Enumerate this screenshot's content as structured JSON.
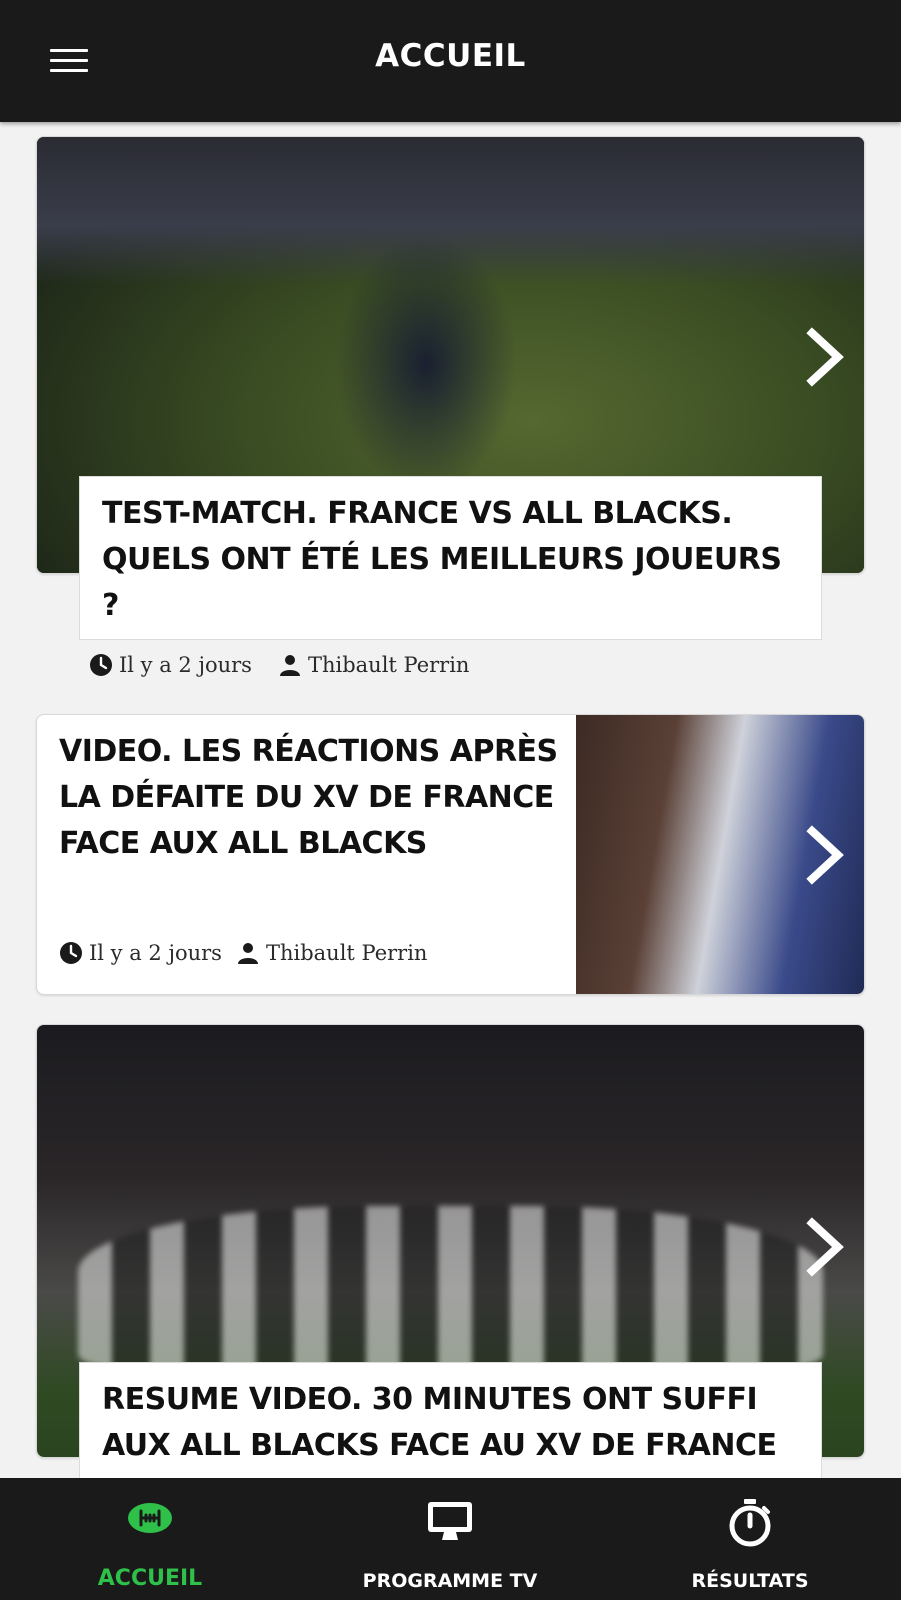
{
  "header": {
    "title": "ACCUEIL",
    "menu_icon": "hamburger-menu-icon"
  },
  "articles": [
    {
      "title": "TEST-MATCH. FRANCE VS ALL BLACKS. QUELS ONT ÉTÉ LES MEILLEURS JOUEURS ?",
      "time": "Il y a 2 jours",
      "author": "Thibault Perrin"
    },
    {
      "title": "VIDEO. LES RÉACTIONS APRÈS LA DÉFAITE DU XV DE FRANCE FACE AUX ALL BLACKS",
      "time": "Il y a 2 jours",
      "author": "Thibault Perrin"
    },
    {
      "title": "RESUME VIDEO. 30 MINUTES ONT SUFFI AUX ALL BLACKS FACE AU XV DE FRANCE"
    }
  ],
  "bottom_nav": {
    "items": [
      {
        "label": "ACCUEIL",
        "icon": "rugby-ball-icon",
        "active": true
      },
      {
        "label": "PROGRAMME TV",
        "icon": "monitor-icon",
        "active": false
      },
      {
        "label": "RÉSULTATS",
        "icon": "stopwatch-icon",
        "active": false
      }
    ]
  },
  "colors": {
    "bar_background": "#1a1a1a",
    "page_background": "#f2f2f2",
    "accent_green": "#2fc04a",
    "text_dark": "#111111"
  }
}
